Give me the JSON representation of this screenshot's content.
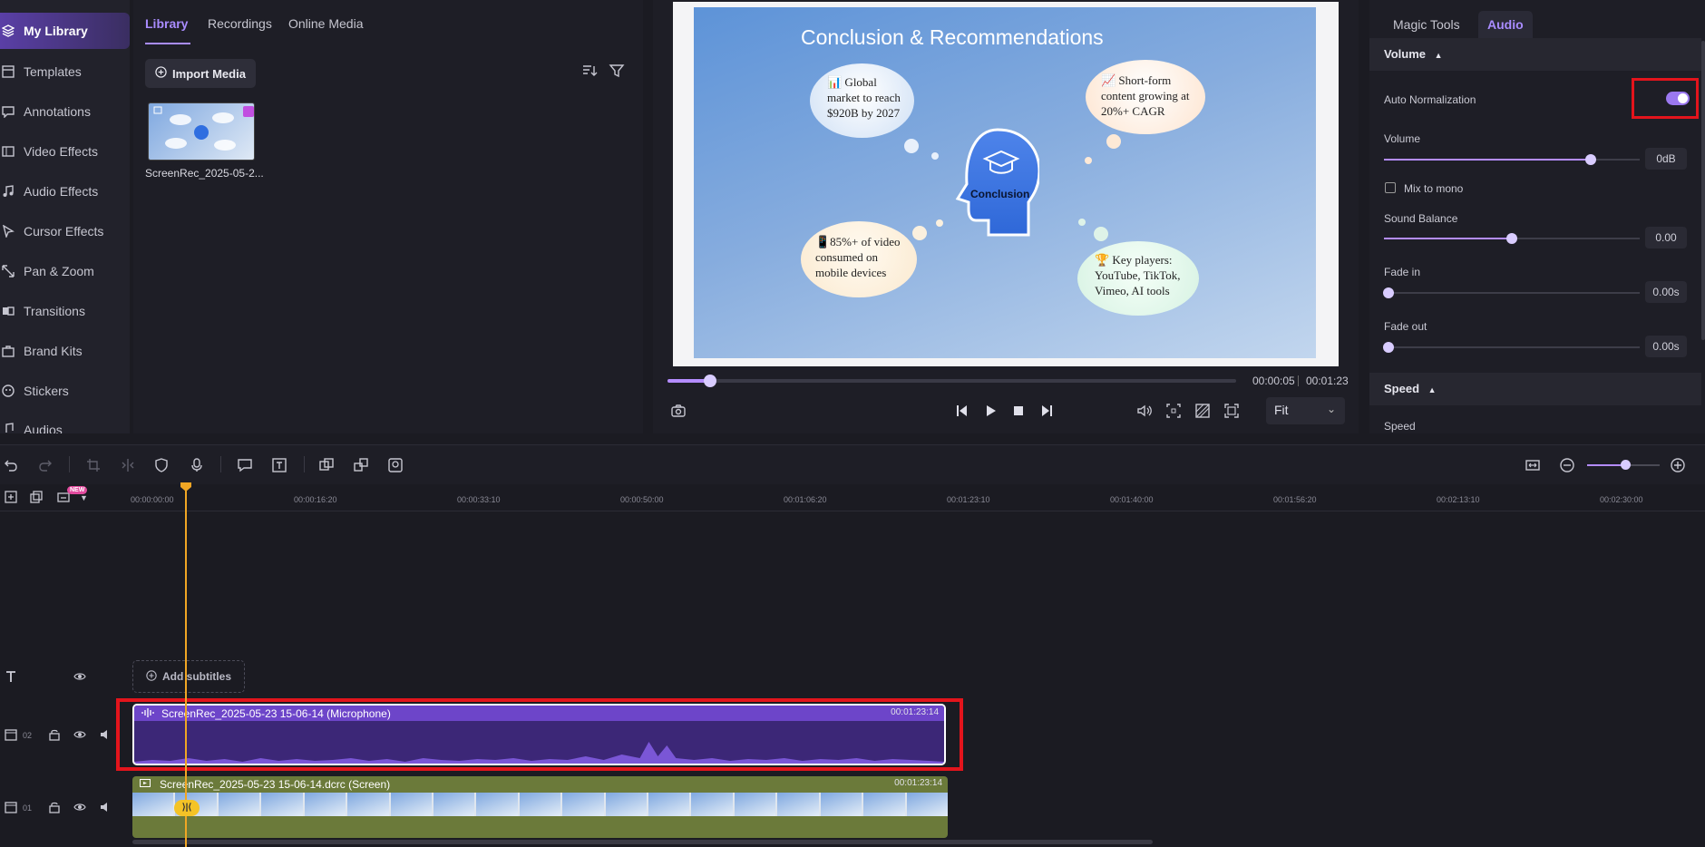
{
  "nav": {
    "items": [
      {
        "label": "My Library",
        "icon": "layers-icon",
        "active": true
      },
      {
        "label": "Templates",
        "icon": "templates-icon"
      },
      {
        "label": "Annotations",
        "icon": "annotation-icon"
      },
      {
        "label": "Video Effects",
        "icon": "video-effects-icon"
      },
      {
        "label": "Audio Effects",
        "icon": "music-note-icon"
      },
      {
        "label": "Cursor Effects",
        "icon": "cursor-icon"
      },
      {
        "label": "Pan & Zoom",
        "icon": "pan-zoom-icon"
      },
      {
        "label": "Transitions",
        "icon": "transition-icon"
      },
      {
        "label": "Brand Kits",
        "icon": "brand-kit-icon"
      },
      {
        "label": "Stickers",
        "icon": "sticker-icon"
      },
      {
        "label": "Audios",
        "icon": "audio-icon"
      }
    ]
  },
  "media": {
    "tabs": [
      "Library",
      "Recordings",
      "Online Media"
    ],
    "import_label": "Import Media",
    "file_name": "ScreenRec_2025-05-2..."
  },
  "preview": {
    "slide": {
      "title": "Conclusion & Recommendations",
      "center_label": "Conclusion",
      "c1": [
        "📊 Global",
        "market to reach",
        "$920B by 2027"
      ],
      "c2": [
        "📈 Short-form",
        "content growing at",
        "20%+ CAGR"
      ],
      "c3": [
        "📱85%+ of video",
        "consumed on",
        "mobile devices"
      ],
      "c4": [
        "🏆 Key players:",
        "YouTube, TikTok,",
        "Vimeo, AI tools"
      ]
    },
    "current_time": "00:00:05",
    "total_time": "00:01:23",
    "progress_fraction": 0.063,
    "fit_label": "Fit"
  },
  "right": {
    "tabs": [
      "Magic Tools",
      "Audio"
    ],
    "volume_section": "Volume",
    "auto_norm_label": "Auto Normalization",
    "auto_norm_on": true,
    "volume_label": "Volume",
    "volume_value": "0dB",
    "mix_mono_label": "Mix to mono",
    "balance_label": "Sound Balance",
    "balance_value": "0.00",
    "fade_in_label": "Fade in",
    "fade_in_value": "0.00s",
    "fade_out_label": "Fade out",
    "fade_out_value": "0.00s",
    "speed_section": "Speed",
    "speed_label": "Speed"
  },
  "timeline": {
    "ticks": [
      "00:00:00:00",
      "00:00:16:20",
      "00:00:33:10",
      "00:00:50:00",
      "00:01:06:20",
      "00:01:23:10",
      "00:01:40:00",
      "00:01:56:20",
      "00:02:13:10",
      "00:02:30:00"
    ],
    "new_badge": "NEW",
    "add_subtitles": "Add subtitles",
    "track2_num": "02",
    "track1_num": "01",
    "audio_clip_name": "ScreenRec_2025-05-23 15-06-14 (Microphone)",
    "audio_clip_dur": "00:01:23:14",
    "video_clip_name": "ScreenRec_2025-05-23 15-06-14.dcrc (Screen)",
    "video_clip_dur": "00:01:23:14",
    "split_marker": "⟩|⟨"
  },
  "colors": {
    "accent": "#a98cff",
    "highlight": "#e3141c",
    "playhead": "#f0a624",
    "audio_clip": "#3c2777",
    "video_clip": "#6b7a3a"
  }
}
